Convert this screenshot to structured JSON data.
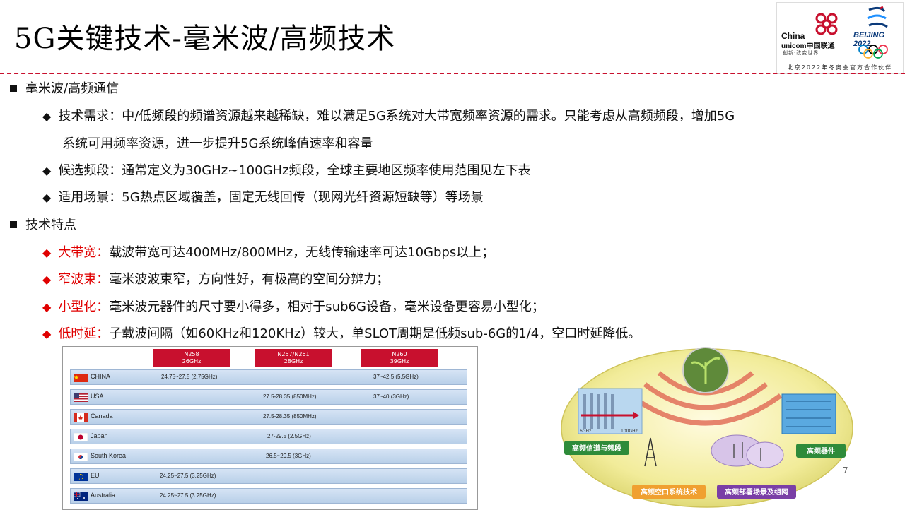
{
  "slide": {
    "title": "5G关键技术-毫米波/高频技术",
    "page_number": "7"
  },
  "logo": {
    "unicom_line1": "China",
    "unicom_line2": "unicom中国联通",
    "unicom_slogan": "创新·改变世界",
    "beijing": "BEIJING 2022",
    "partner_tag": "北京2022年冬奥会官方合作伙伴",
    "colors": {
      "unicom_red": "#c8102e",
      "beijing_blue": "#0b3a7a"
    }
  },
  "content": {
    "section1": "毫米波/高频通信",
    "b1": "技术需求：中/低频段的频谱资源越来越稀缺，难以满足5G系统对大带宽频率资源的需求。只能考虑从高频频段，增加5G",
    "b1_cont": "系统可用频率资源，进一步提升5G系统峰值速率和容量",
    "b2": "候选频段：通常定义为30GHz~100GHz频段，全球主要地区频率使用范围见左下表",
    "b3": "适用场景：5G热点区域覆盖，固定无线回传（现网光纤资源短缺等）等场景",
    "section2": "技术特点",
    "f1_label": "大带宽：",
    "f1_text": "载波带宽可达400MHz/800MHz，无线传输速率可达10Gbps以上；",
    "f2_label": "窄波束：",
    "f2_text": "毫米波波束窄，方向性好，有极高的空间分辨力；",
    "f3_label": "小型化：",
    "f3_text": "毫米波元器件的尺寸要小得多，相对于sub6G设备，毫米设备更容易小型化；",
    "f4_label": "低时延：",
    "f4_text": "子载波间隔（如60KHz和120KHz）较大，单SLOT周期是低频sub-6G的1/4，空口时延降低。",
    "accent_color": "#e00000"
  },
  "band_table": {
    "headers": [
      {
        "band": "N258",
        "freq": "26GHz"
      },
      {
        "band": "N257/N261",
        "freq": "28GHz"
      },
      {
        "band": "N260",
        "freq": "39GHz"
      }
    ],
    "rows": [
      {
        "country": "CHINA",
        "flag": "china-flag",
        "n258": "24.75~27.5 (2.75GHz)",
        "n257": "",
        "n260": "37~42.5 (5.5GHz)"
      },
      {
        "country": "USA",
        "flag": "usa-flag",
        "n258": "",
        "n257": "27.5-28.35 (850MHz)",
        "n260": "37~40 (3GHz)"
      },
      {
        "country": "Canada",
        "flag": "canada-flag",
        "n258": "",
        "n257": "27.5-28.35 (850MHz)",
        "n260": ""
      },
      {
        "country": "Japan",
        "flag": "japan-flag",
        "n258": "",
        "n257": "27-29.5 (2.5GHz)",
        "n260": ""
      },
      {
        "country": "South Korea",
        "flag": "korea-flag",
        "n258": "",
        "n257": "26.5~29.5 (3GHz)",
        "n260": ""
      },
      {
        "country": "EU",
        "flag": "eu-flag",
        "n258": "24.25~27.5 (3.25GHz)",
        "n257": "",
        "n260": ""
      },
      {
        "country": "Australia",
        "flag": "australia-flag",
        "n258": "24.25~27.5 (3.25GHz)",
        "n257": "",
        "n260": ""
      }
    ]
  },
  "diagram": {
    "label_channel": "高频信道与频段",
    "label_device": "高频器件",
    "label_air": "高频空口系统技术",
    "label_deploy": "高频部署场景及组网",
    "axis_start": "6GHz",
    "axis_end": "100GHz"
  }
}
